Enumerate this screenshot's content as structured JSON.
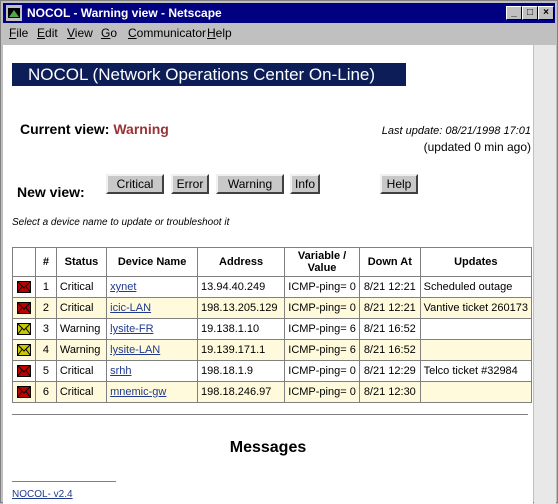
{
  "window": {
    "title": "NOCOL - Warning view - Netscape"
  },
  "menubar": {
    "items": [
      {
        "label": "File",
        "accel": "F"
      },
      {
        "label": "Edit",
        "accel": "E"
      },
      {
        "label": "View",
        "accel": "V"
      },
      {
        "label": "Go",
        "accel": "G"
      },
      {
        "label": "Communicator",
        "accel": "C"
      },
      {
        "label": "Help",
        "accel": "H"
      }
    ]
  },
  "page": {
    "banner": "NOCOL (Network Operations Center On-Line)",
    "current_view_label": "Current view:",
    "current_view_value": "Warning",
    "last_update": "Last update: 08/21/1998 17:01",
    "updated_ago": "(updated 0 min ago)",
    "new_view_label": "New view:",
    "buttons": {
      "critical": "Critical",
      "error": "Error",
      "warning": "Warning",
      "info": "Info",
      "help": "Help"
    },
    "hint": "Select a device name to update or troubleshoot it",
    "messages_heading": "Messages",
    "footer_link": "NOCOL- v2.4"
  },
  "table": {
    "headers": [
      "#",
      "Status",
      "Device Name",
      "Address",
      "Variable / Value",
      "Down At",
      "Updates"
    ],
    "rows": [
      {
        "num": "1",
        "status": "Critical",
        "device": "xynet",
        "address": "13.94.40.249",
        "variable": "ICMP-ping= 0",
        "down_at": "8/21 12:21",
        "updates": "Scheduled outage",
        "severity": "critical"
      },
      {
        "num": "2",
        "status": "Critical",
        "device": "icic-LAN",
        "address": "198.13.205.129",
        "variable": "ICMP-ping= 0",
        "down_at": "8/21 12:21",
        "updates": "Vantive ticket 260173",
        "severity": "critical"
      },
      {
        "num": "3",
        "status": "Warning",
        "device": "lysite-FR",
        "address": "19.138.1.10",
        "variable": "ICMP-ping= 6",
        "down_at": "8/21 16:52",
        "updates": "",
        "severity": "warning"
      },
      {
        "num": "4",
        "status": "Warning",
        "device": "lysite-LAN",
        "address": "19.139.171.1",
        "variable": "ICMP-ping= 6",
        "down_at": "8/21 16:52",
        "updates": "",
        "severity": "warning"
      },
      {
        "num": "5",
        "status": "Critical",
        "device": "srhh",
        "address": "198.18.1.9",
        "variable": "ICMP-ping= 0",
        "down_at": "8/21 12:29",
        "updates": "Telco ticket #32984",
        "severity": "critical"
      },
      {
        "num": "6",
        "status": "Critical",
        "device": "mnemic-gw",
        "address": "198.18.246.97",
        "variable": "ICMP-ping= 0",
        "down_at": "8/21 12:30",
        "updates": "",
        "severity": "critical"
      }
    ]
  },
  "colors": {
    "critical_icon": "#c00000",
    "warning_icon": "#c8c800",
    "banner_bg": "#0d1d57",
    "view_value": "#993333"
  }
}
